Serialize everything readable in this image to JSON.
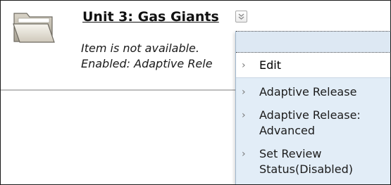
{
  "item": {
    "title": "Unit 3: Gas Giants",
    "status_line_1": "Item is not available.",
    "status_line_2": "Enabled: Adaptive Rele"
  },
  "icons": {
    "folder": "folder-icon",
    "menu_toggle": "double-chevron-down-icon",
    "menu_arrow": "chevron-right-icon"
  },
  "context_menu": {
    "items": [
      {
        "label": "Edit"
      },
      {
        "label": "Adaptive Release"
      },
      {
        "label": "Adaptive Release: Advanced"
      },
      {
        "label": "Set Review Status(Disabled)"
      }
    ],
    "arrow_glyph": "›"
  },
  "colors": {
    "menu_bg": "#e2edf7",
    "highlight_bg": "#ffffff"
  }
}
